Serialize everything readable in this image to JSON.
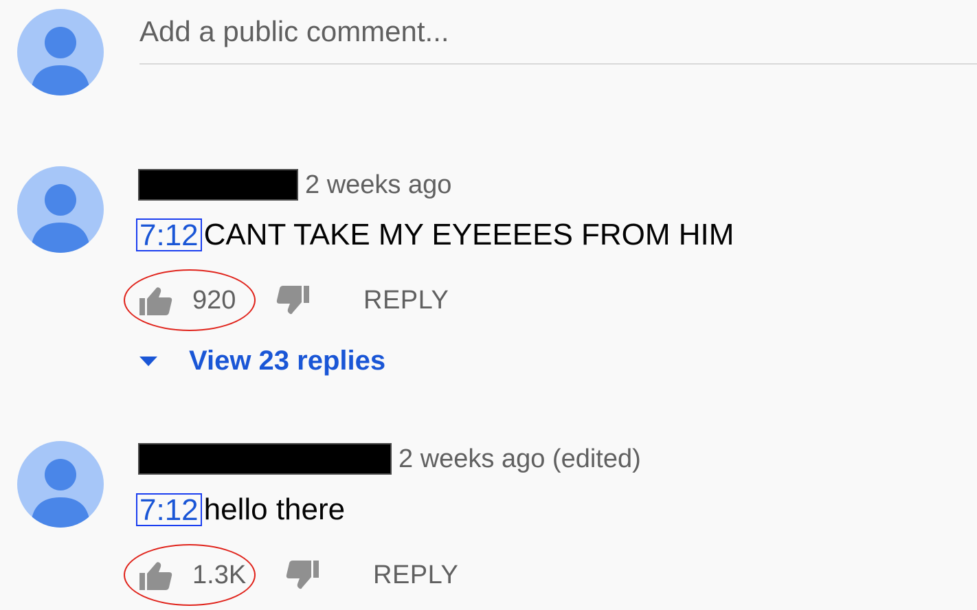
{
  "comment_box": {
    "placeholder": "Add a public comment..."
  },
  "comments": [
    {
      "author_redacted": true,
      "timestamp": "2 weeks ago",
      "time_link": "7:12",
      "text": "CANT TAKE MY EYEEEES FROM HIM",
      "like_count": "920",
      "reply_label": "REPLY",
      "view_replies": "View 23 replies"
    },
    {
      "author_redacted": true,
      "timestamp": "2 weeks ago (edited)",
      "time_link": "7:12",
      "text": "hello there",
      "like_count": "1.3K",
      "reply_label": "REPLY"
    }
  ],
  "icons": {
    "avatar": "default-user-avatar-icon",
    "like": "thumbs-up-icon",
    "dislike": "thumbs-down-icon",
    "expand": "caret-down-icon"
  },
  "colors": {
    "background": "#f9f9f9",
    "avatar_bg": "#a6c6f8",
    "avatar_fg": "#4a86e8",
    "link_blue": "#1a56d6",
    "annotation_red": "#e0231b",
    "annotation_blue": "#1a3ef0",
    "secondary_text": "#606060"
  }
}
